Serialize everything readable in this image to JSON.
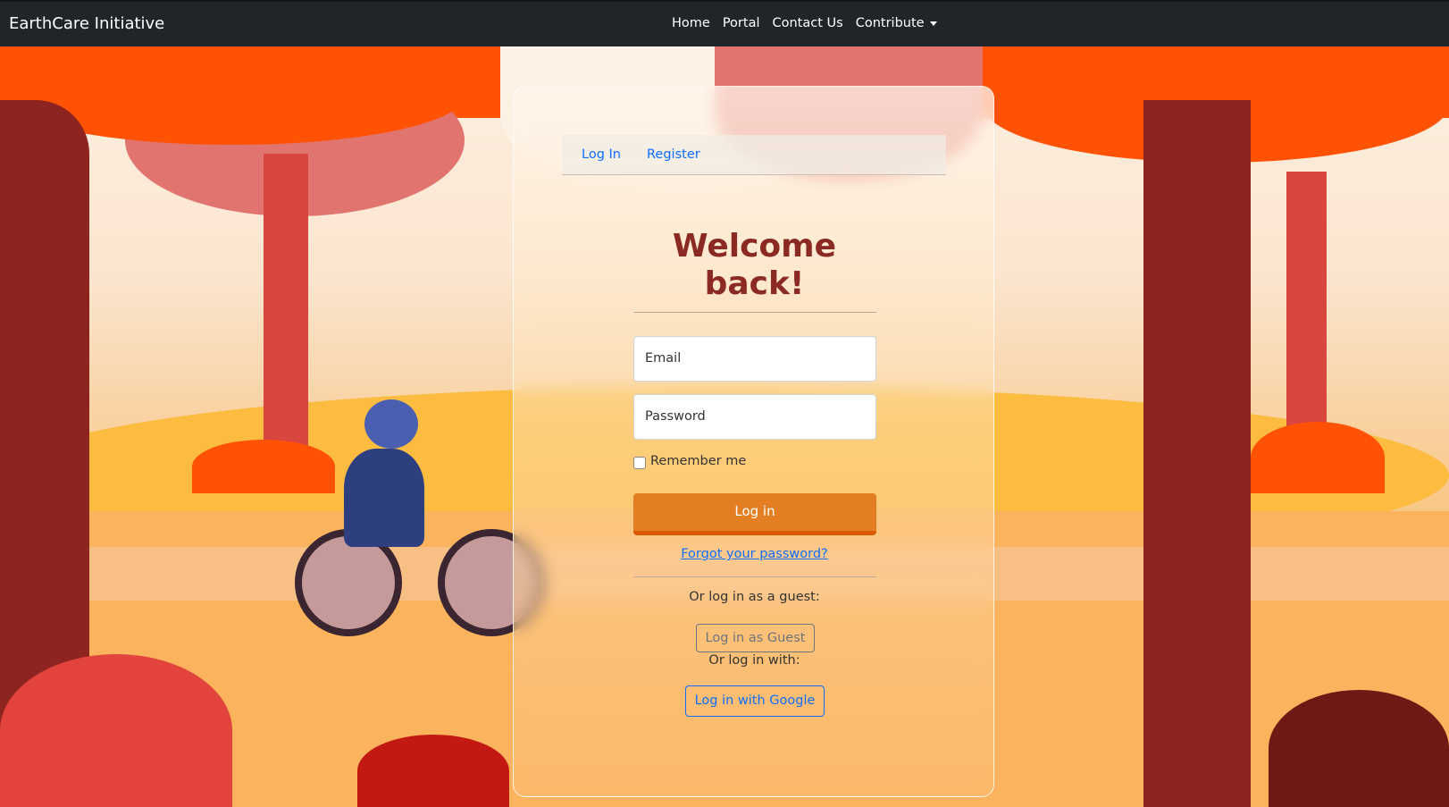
{
  "navbar": {
    "brand": "EarthCare Initiative",
    "links": [
      "Home",
      "Portal",
      "Contact Us",
      "Contribute"
    ]
  },
  "tabs": [
    "Log In",
    "Register"
  ],
  "form": {
    "title_line1": "Welcome",
    "title_line2": "back!",
    "email_placeholder": "Email",
    "password_placeholder": "Password",
    "remember_label": "Remember me",
    "login_button": "Log in",
    "forgot_link": "Forgot your password?",
    "guest_prompt": "Or log in as a guest:",
    "guest_button": "Log in as Guest",
    "external_prompt": "Or log in with:",
    "google_button": "Log in with Google"
  },
  "colors": {
    "navbar": "#212529",
    "title": "#8b2a22",
    "primary_button": "#e47e22",
    "link": "#0d6efd"
  }
}
